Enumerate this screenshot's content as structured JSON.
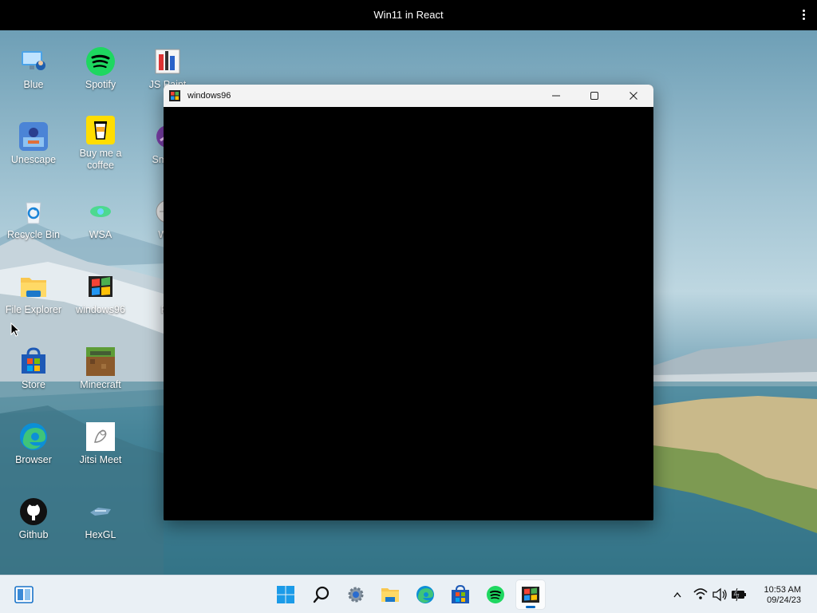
{
  "browser": {
    "title": "Win11 in React",
    "menu_icon": "kebab-menu-icon"
  },
  "desktop": {
    "icons": [
      {
        "id": "blue",
        "label": "Blue",
        "icon": "user-monitor-icon"
      },
      {
        "id": "spotify",
        "label": "Spotify",
        "icon": "spotify-icon"
      },
      {
        "id": "jspaint",
        "label": "JS Paint",
        "icon": "paint-icon"
      },
      {
        "id": "unescape",
        "label": "Unescape",
        "icon": "unescape-icon"
      },
      {
        "id": "buymeacoffee",
        "label": "Buy me a coffee",
        "icon": "coffee-cup-icon"
      },
      {
        "id": "smash",
        "label": "Smash",
        "icon": "smash-icon"
      },
      {
        "id": "recycle",
        "label": "Recycle Bin",
        "icon": "recycle-bin-icon"
      },
      {
        "id": "wsa",
        "label": "WSA",
        "icon": "wsa-icon"
      },
      {
        "id": "wiki",
        "label": "Wiki",
        "icon": "wikipedia-icon"
      },
      {
        "id": "fileexplorer",
        "label": "File Explorer",
        "icon": "folder-icon"
      },
      {
        "id": "windows96",
        "label": "windows96",
        "icon": "windows96-icon"
      },
      {
        "id": "fn",
        "label": "FN",
        "icon": "fn-icon"
      },
      {
        "id": "store",
        "label": "Store",
        "icon": "store-icon"
      },
      {
        "id": "minecraft",
        "label": "Minecraft",
        "icon": "minecraft-icon"
      },
      {
        "id": "browser",
        "label": "Browser",
        "icon": "edge-browser-icon"
      },
      {
        "id": "jitsi",
        "label": "Jitsi Meet",
        "icon": "jitsi-icon"
      },
      {
        "id": "github",
        "label": "Github",
        "icon": "github-icon"
      },
      {
        "id": "hexgl",
        "label": "HexGL",
        "icon": "hexgl-icon"
      }
    ]
  },
  "window": {
    "title": "windows96",
    "icon": "windows96-icon",
    "controls": {
      "minimize": "minimize-icon",
      "maximize": "maximize-icon",
      "close": "close-icon"
    }
  },
  "taskbar": {
    "widgets_icon": "widgets-icon",
    "pinned": [
      {
        "id": "start",
        "icon": "windows-start-icon"
      },
      {
        "id": "search",
        "icon": "search-icon"
      },
      {
        "id": "settings",
        "icon": "settings-gear-icon"
      },
      {
        "id": "explorer",
        "icon": "folder-icon"
      },
      {
        "id": "edge",
        "icon": "edge-browser-icon"
      },
      {
        "id": "store",
        "icon": "store-icon"
      },
      {
        "id": "spotify",
        "icon": "spotify-icon"
      },
      {
        "id": "windows96",
        "icon": "windows96-icon",
        "active": true
      }
    ],
    "tray": {
      "chevron": "chevron-up-icon",
      "wifi": "wifi-icon",
      "volume": "volume-icon",
      "battery": "battery-charging-icon"
    },
    "time": "10:53 AM",
    "date": "09/24/23"
  },
  "colors": {
    "accent": "#0067c0",
    "spotify": "#1ed760",
    "taskbar_bg": "#eaf0f5"
  }
}
